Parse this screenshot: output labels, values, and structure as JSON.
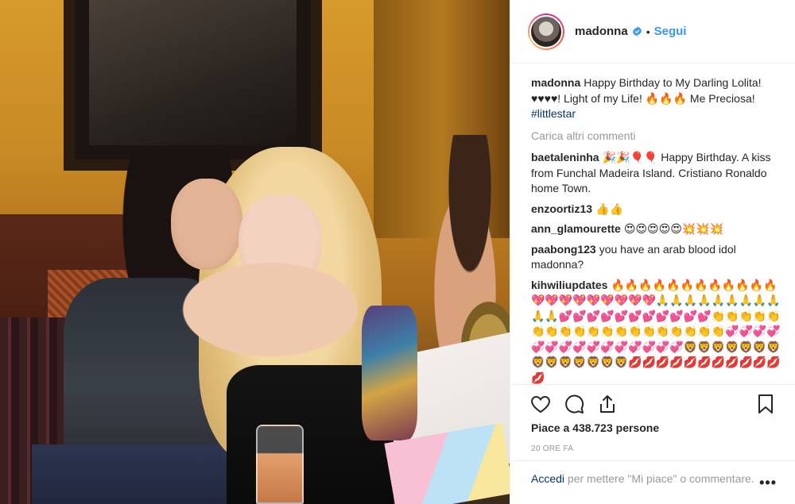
{
  "post": {
    "image_alt": "Foto del post"
  },
  "header": {
    "username": "madonna",
    "dot": "•",
    "follow_label": "Segui"
  },
  "caption": {
    "user": "madonna",
    "text": "Happy Birthday to My Darling Lolita! ♥♥♥♥! Light of my Life! 🔥🔥🔥 Me Preciosa! ",
    "hashtag": "#littlestar"
  },
  "load_more": "Carica altri commenti",
  "comments": [
    {
      "user": "baetaleninha",
      "text": "🎉🎉🎈🎈 Happy Birthday. A kiss from Funchal Madeira Island. Cristiano Ronaldo home Town."
    },
    {
      "user": "enzoortiz13",
      "text": "👍👍"
    },
    {
      "user": "ann_glamourette",
      "text": "😍😍😍😍😍💥💥💥"
    },
    {
      "user": "paabong123",
      "text": "you have an arab blood idol madonna?"
    },
    {
      "user": "kihwiliupdates",
      "text": "🔥🔥🔥🔥🔥🔥🔥🔥🔥🔥🔥🔥💖💖💖💖💖💖💖💖💖🙏🙏🙏🙏🙏🙏🙏🙏🙏🙏🙏💕💕💕💕💕💕💕💕💕💕💕👏👏👏👏👏👏👏👏👏👏👏👏👏👏👏👏👏👏👏💞💞💞💞💞💞💞💞💞💞💞💞💞💞💞🦁🦁🦁🦁🦁🦁🦁🦁🦁🦁🦁🦁🦁🦁💋💋💋💋💋💋💋💋💋💋💋💋"
    }
  ],
  "actions": {
    "like_icon": "heart-icon",
    "comment_icon": "comment-icon",
    "share_icon": "share-icon",
    "save_icon": "bookmark-icon"
  },
  "likes_text": "Piace a 438.723 persone",
  "timestamp": "20 ORE FA",
  "footer": {
    "login_label": "Accedi",
    "rest_text": " per mettere \"Mi piace\" o commentare.",
    "more_label": "•••"
  },
  "colors": {
    "link_blue": "#3897f0",
    "hashtag_blue": "#003569",
    "muted": "#999999",
    "text": "#262626"
  }
}
